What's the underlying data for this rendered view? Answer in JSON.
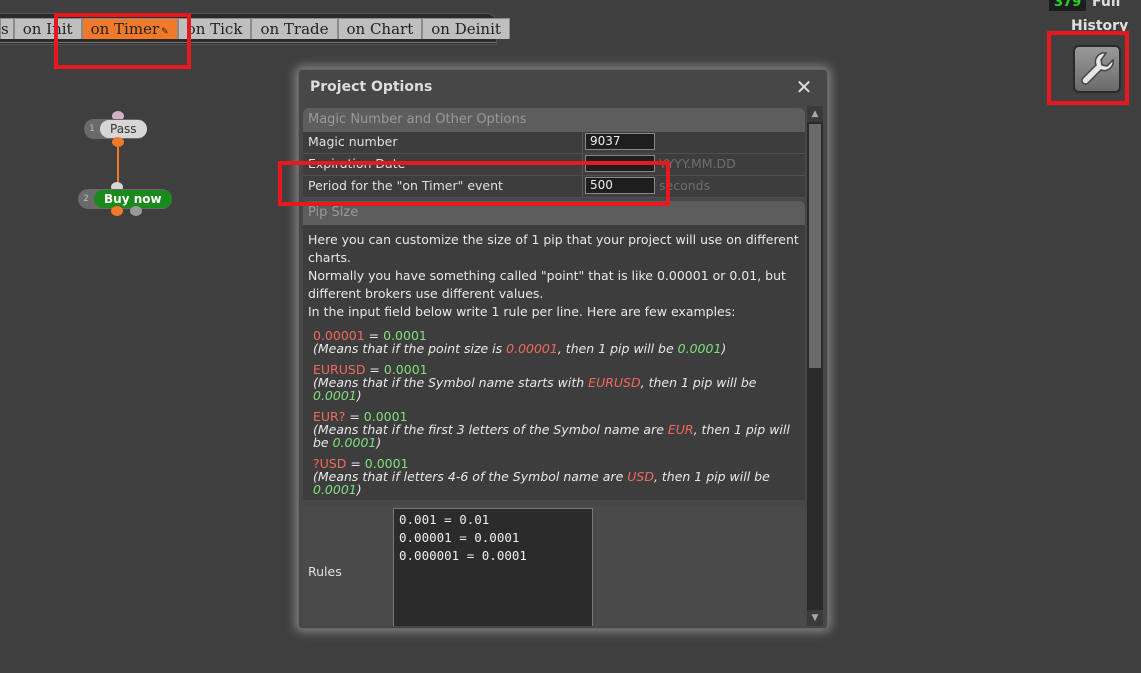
{
  "tabs": [
    {
      "label": "s"
    },
    {
      "label": "on Init"
    },
    {
      "label": "on Timer"
    },
    {
      "label": "on Tick"
    },
    {
      "label": "on Trade"
    },
    {
      "label": "on Chart"
    },
    {
      "label": "on Deinit"
    }
  ],
  "topright": {
    "counter": "379",
    "counter_label": "Full",
    "history_label": "History"
  },
  "flow": {
    "pass_node": {
      "num": "1",
      "label": "Pass"
    },
    "buy_node": {
      "num": "2",
      "label": "Buy now"
    }
  },
  "dialog": {
    "title": "Project Options",
    "magic_section": {
      "title": "Magic Number and Other Options",
      "magic_label": "Magic number",
      "magic_value": "9037",
      "expiration_label": "Expiration Date",
      "expiration_value": "",
      "expiration_hint": "YYYY.MM.DD",
      "period_label": "Period for the \"on Timer\" event",
      "period_value": "500",
      "period_hint": "seconds"
    },
    "pip_section": {
      "title": "Pip Size",
      "intro1": "Here you can customize the size of 1 pip that your project will use on different charts.",
      "intro2": "Normally you have something called \"point\" that is like 0.00001 or 0.01, but different brokers use different values.",
      "intro3": "In the input field below write 1 rule per line. Here are few examples:",
      "ex1": {
        "left": "0.00001",
        "right": "0.0001",
        "n1": "(Means that if the point size is ",
        "v1": "0.00001",
        "n2": ", then 1 pip will be ",
        "v2": "0.0001",
        "n3": ")"
      },
      "ex2": {
        "left": "EURUSD",
        "right": "0.0001",
        "n1": "(Means that if the Symbol name starts with ",
        "v1": "EURUSD",
        "n2": ", then 1 pip will be ",
        "v2": "0.0001",
        "n3": ")"
      },
      "ex3": {
        "left": "EUR?",
        "right": "0.0001",
        "n1": "(Means that if the first 3 letters of the Symbol name are ",
        "v1": "EUR",
        "n2": ", then 1 pip will be ",
        "v2": "0.0001",
        "n3": ")"
      },
      "ex4": {
        "left": "?USD",
        "right": "0.0001",
        "n1": "(Means that if letters 4-6 of the Symbol name are ",
        "v1": "USD",
        "n2": ", then 1 pip will be ",
        "v2": "0.0001",
        "n3": ")"
      },
      "equals": " = ",
      "rules_label": "Rules",
      "rules_value": "0.001 = 0.01\n0.00001 = 0.0001\n0.000001 = 0.0001"
    }
  },
  "colors": {
    "highlight": "#e8191e",
    "active_tab": "#f07a2a",
    "buy_node": "#1a8a1a"
  },
  "icons": {
    "close": "close-icon",
    "tool": "wrench-icon"
  }
}
